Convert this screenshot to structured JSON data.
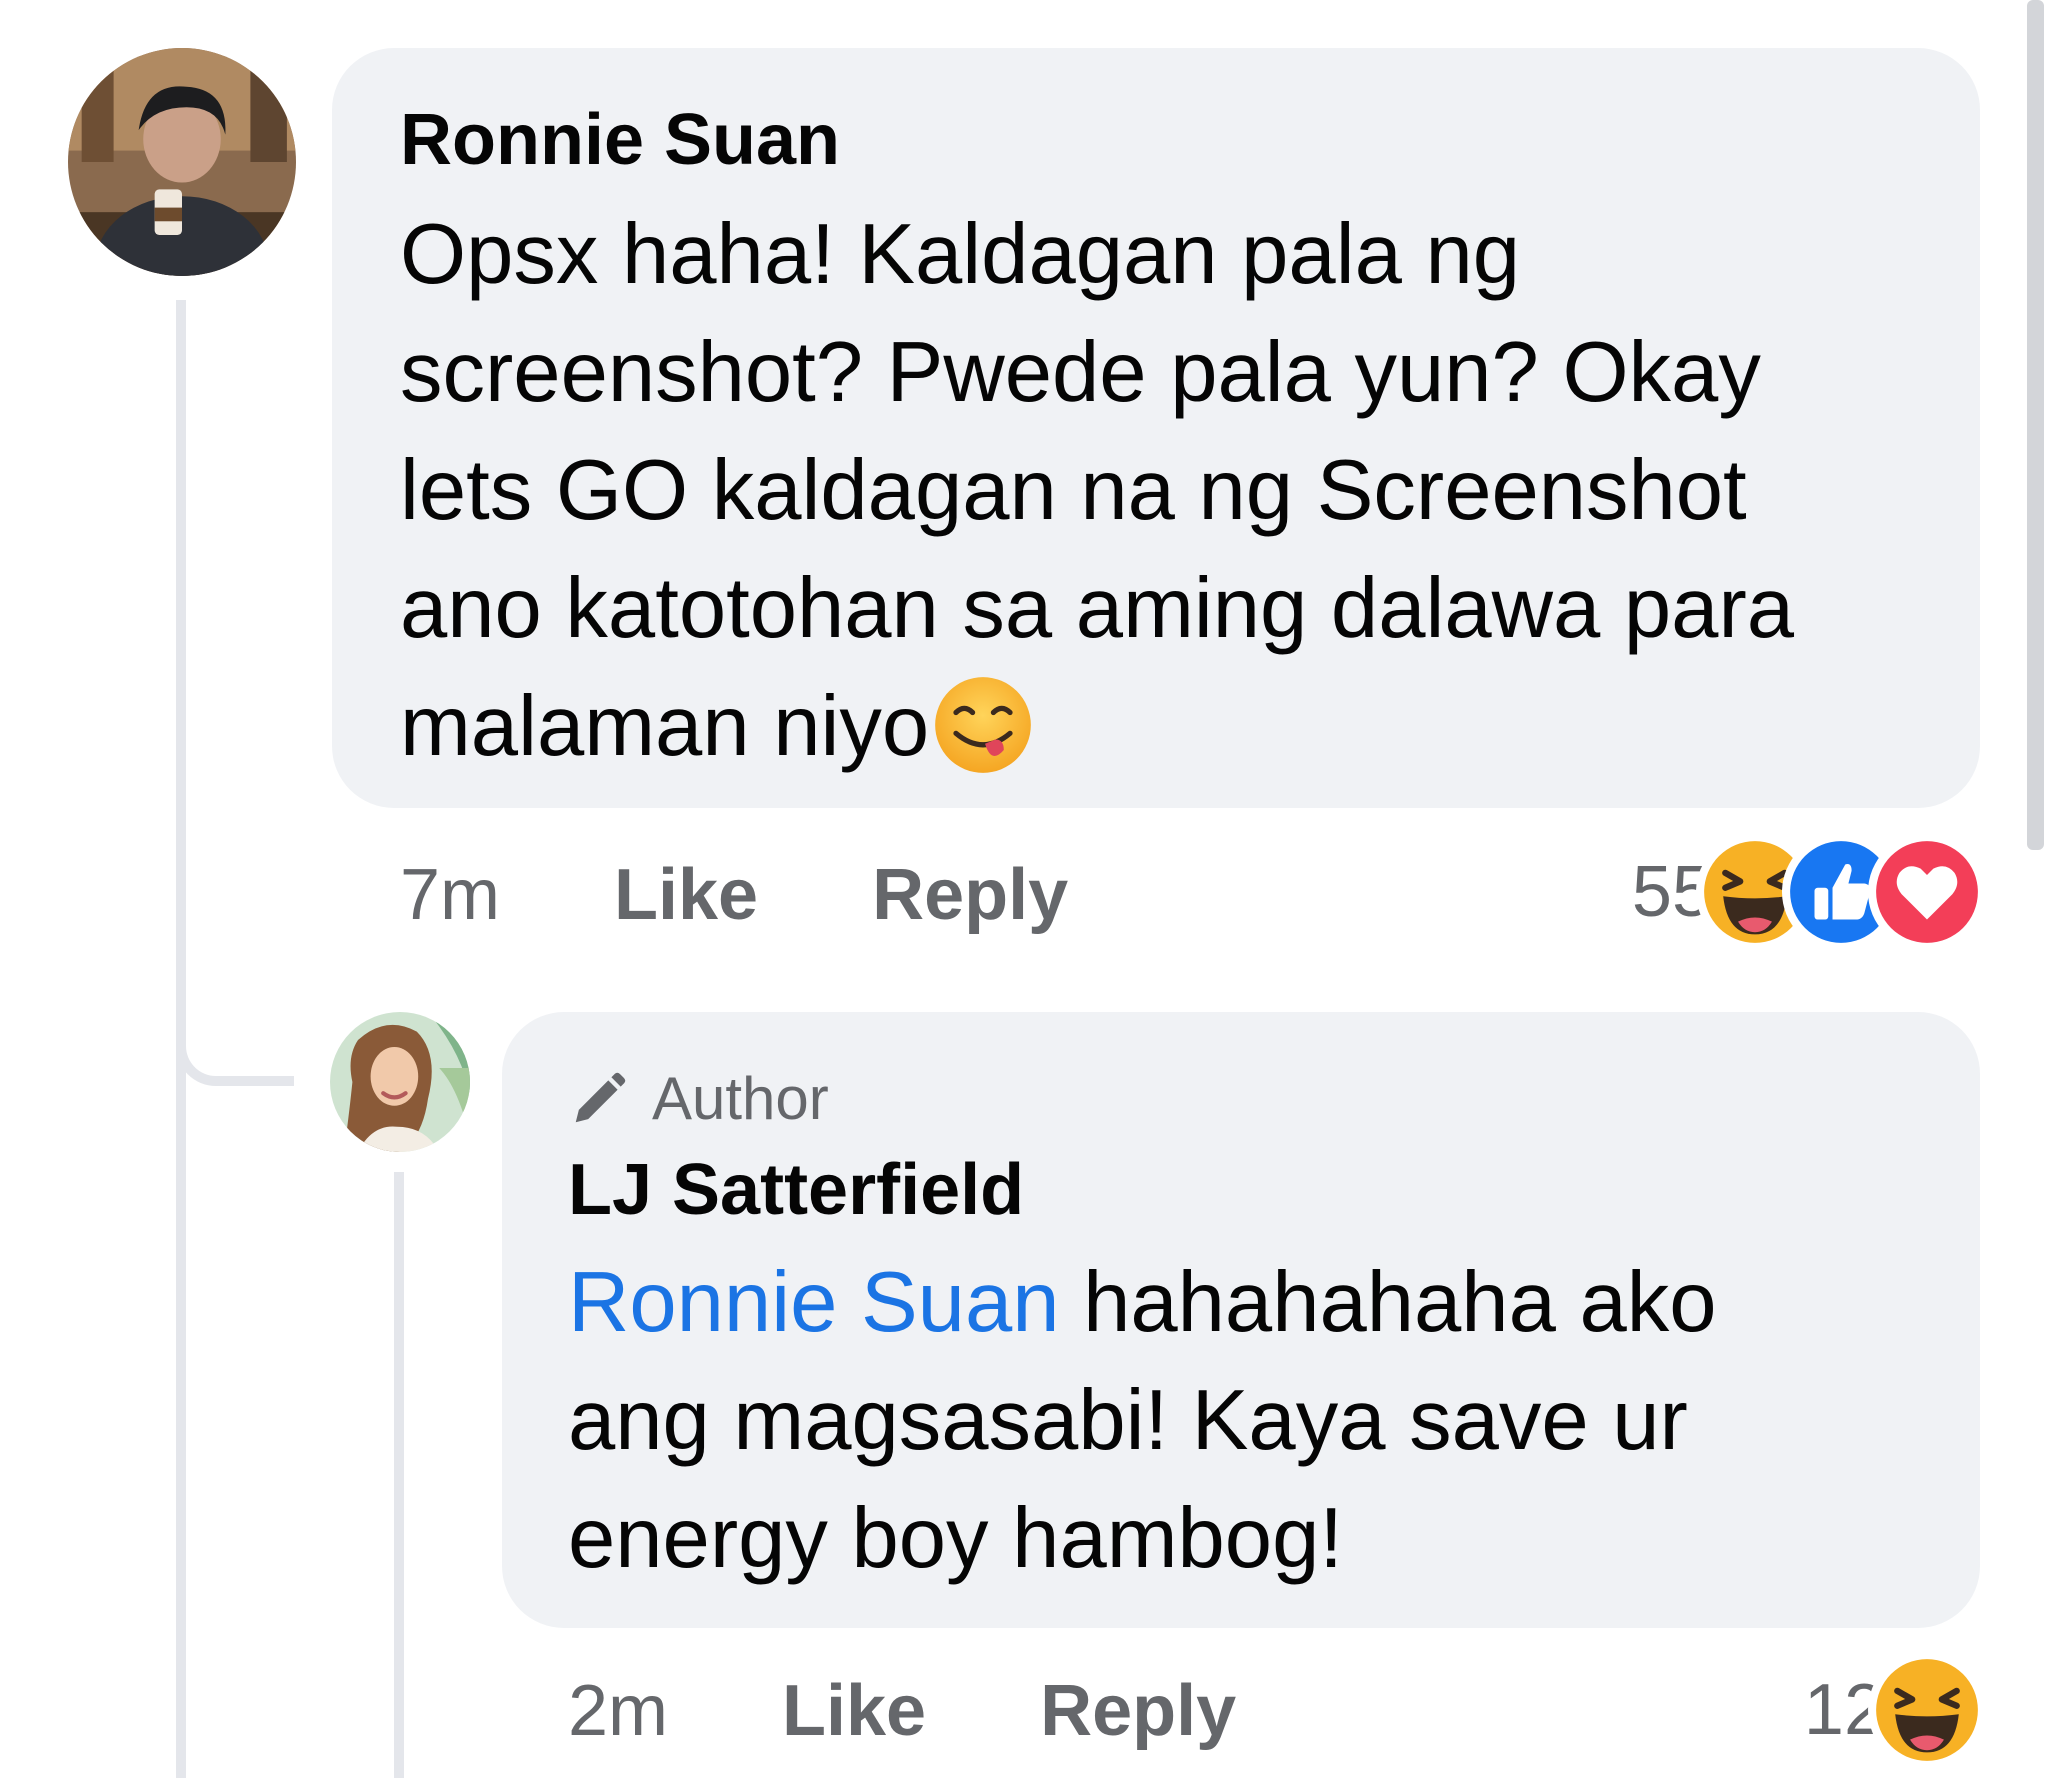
{
  "comment": {
    "author": "Ronnie Suan",
    "text_lines": [
      "Opsx haha! Kaldagan pala ng",
      "screenshot? Pwede pala yun? Okay",
      "lets GO kaldagan na ng Screenshot",
      "ano katotohan sa aming dalawa para",
      "malaman niyo"
    ],
    "trailing_emoji": "face-savoring-food-emoji",
    "time": "7m",
    "like_label": "Like",
    "reply_label": "Reply",
    "reaction_count": "55",
    "reactions": [
      "haha-reaction-icon",
      "like-reaction-icon",
      "love-reaction-icon"
    ]
  },
  "reply": {
    "badge_label": "Author",
    "author": "LJ Satterfield",
    "mention": "Ronnie Suan",
    "text_first_rest": " hahahahaha ako",
    "text_lines": [
      "ang magsasabi! Kaya save ur",
      "energy boy hambog!"
    ],
    "time": "2m",
    "like_label": "Like",
    "reply_label": "Reply",
    "reaction_count": "12",
    "reactions": [
      "haha-reaction-icon"
    ]
  },
  "colors": {
    "bubble": "#f0f2f5",
    "meta_text": "#65676b",
    "mention": "#1b74e4",
    "like_blue": "#1877f2",
    "love_red": "#f33e58",
    "haha_yellow": "#f7b125"
  }
}
